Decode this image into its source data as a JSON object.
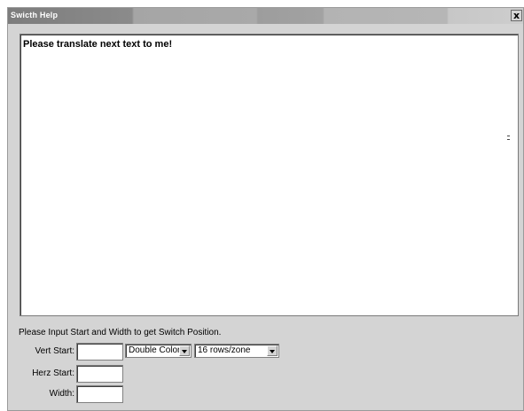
{
  "window": {
    "title": "Swicth Help",
    "close_glyph": "x"
  },
  "content": {
    "text": "Please translate next text to me!"
  },
  "form": {
    "instruction": "Please Input Start and Width to get  Switch Position.",
    "vert_start": {
      "label": "Vert Start:",
      "value": ""
    },
    "herz_start": {
      "label": "Herz Start:",
      "value": ""
    },
    "width": {
      "label": "Width:",
      "value": ""
    },
    "color_select": {
      "selected": "Double Color"
    },
    "rows_select": {
      "selected": "16 rows/zone"
    }
  },
  "icons": {
    "close": "close-icon",
    "dropdown": "chevron-down-icon"
  }
}
